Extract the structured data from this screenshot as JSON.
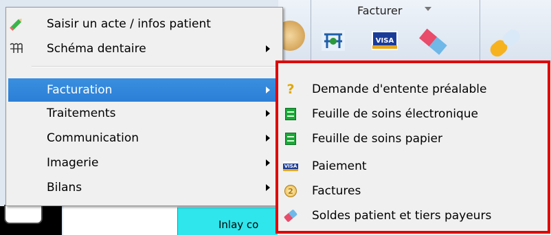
{
  "toolbar": {
    "group_title": "Facturer"
  },
  "background": {
    "cell_text": "Inlay co"
  },
  "menu": {
    "items": [
      {
        "label": "Saisir un acte / infos patient",
        "icon": "pencil-icon",
        "has_submenu": false
      },
      {
        "label": "Schéma dentaire",
        "icon": "teeth-icon",
        "has_submenu": true
      },
      {
        "label": "Facturation",
        "icon": "",
        "has_submenu": true,
        "highlighted": true
      },
      {
        "label": "Traitements",
        "icon": "",
        "has_submenu": true
      },
      {
        "label": "Communication",
        "icon": "",
        "has_submenu": true
      },
      {
        "label": "Imagerie",
        "icon": "",
        "has_submenu": true
      },
      {
        "label": "Bilans",
        "icon": "",
        "has_submenu": true
      }
    ]
  },
  "submenu": {
    "items": [
      {
        "label": "Demande d'entente préalable",
        "icon": "question-icon"
      },
      {
        "label": "Feuille de soins électronique",
        "icon": "green-sheet-icon"
      },
      {
        "label": "Feuille de soins papier",
        "icon": "green-sheet-icon"
      },
      {
        "label": "Paiement",
        "icon": "visa-card-icon"
      },
      {
        "label": "Factures",
        "icon": "coin-icon",
        "icon_text": "2"
      },
      {
        "label": "Soldes patient et tiers payeurs",
        "icon": "eraser-icon"
      }
    ],
    "highlight_color": "#e00000"
  },
  "colors": {
    "menu_bg": "#f0f0f0",
    "highlight": "#3a8fe0",
    "cyan_cell": "#2ee6ec"
  }
}
